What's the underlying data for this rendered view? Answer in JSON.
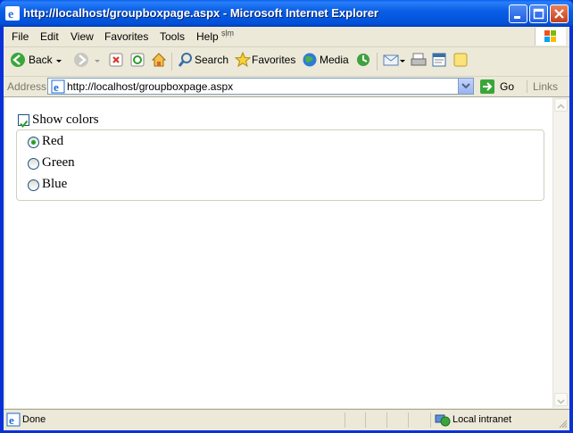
{
  "window": {
    "title": "http://localhost/groupboxpage.aspx - Microsoft Internet Explorer"
  },
  "menu": {
    "items": [
      "File",
      "Edit",
      "View",
      "Favorites",
      "Tools",
      "Help"
    ],
    "partial": "ṣḷṃ"
  },
  "toolbar": {
    "back": "Back",
    "search": "Search",
    "favorites": "Favorites",
    "media": "Media"
  },
  "address": {
    "label": "Address",
    "url": "http://localhost/groupboxpage.aspx",
    "go": "Go",
    "links": "Links"
  },
  "page": {
    "show_colors": {
      "label": "Show colors",
      "checked": true
    },
    "colors": [
      {
        "label": "Red",
        "selected": true
      },
      {
        "label": "Green",
        "selected": false
      },
      {
        "label": "Blue",
        "selected": false
      }
    ]
  },
  "status": {
    "text": "Done",
    "zone": "Local intranet"
  },
  "colors": {
    "title_bar": "#0054e3",
    "chrome": "#ece9d8",
    "radio_dot": "#21a121"
  }
}
